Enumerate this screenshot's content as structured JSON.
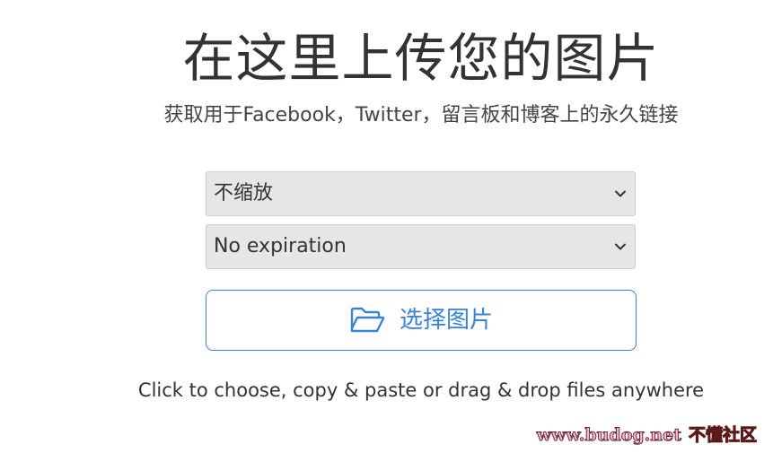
{
  "header": {
    "title": "在这里上传您的图片",
    "subtitle": "获取用于Facebook，Twitter，留言板和博客上的永久链接"
  },
  "options": {
    "resize_value": "不缩放",
    "expiration_value": "No expiration"
  },
  "upload": {
    "button_label": "选择图片",
    "icon": "folder-open-icon"
  },
  "hint": "Click to choose, copy & paste or drag & drop files anywhere",
  "watermark": {
    "site": "www.budog.net",
    "label": "不懂社区"
  },
  "colors": {
    "accent": "#3b82d6",
    "text": "#333333",
    "select_bg": "#e6e6e6"
  }
}
